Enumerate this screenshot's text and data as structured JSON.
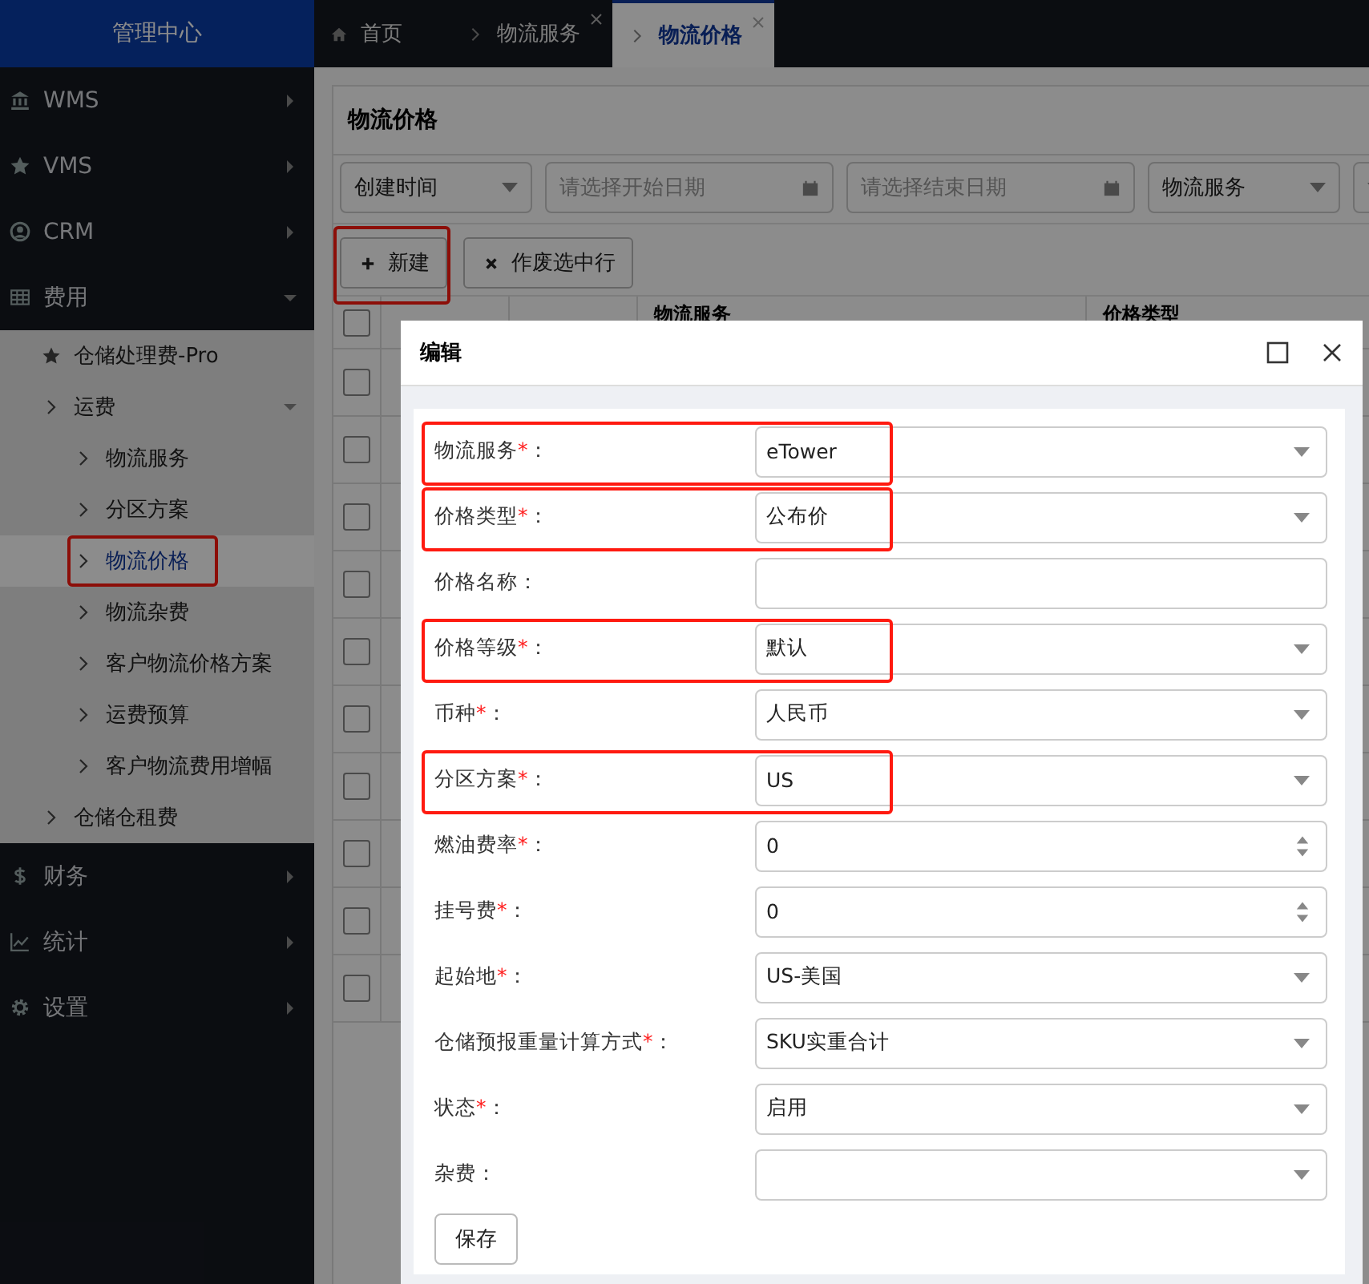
{
  "brand": "管理中心",
  "sidebar": {
    "items": [
      {
        "label": "WMS",
        "expanded": false
      },
      {
        "label": "VMS",
        "expanded": false
      },
      {
        "label": "CRM",
        "expanded": false
      },
      {
        "label": "费用",
        "expanded": true,
        "children": [
          {
            "label": "仓储处理费-Pro",
            "expanded": false,
            "selected": false,
            "highlighted": false
          },
          {
            "label": "运费",
            "expanded": true,
            "selected": false,
            "highlighted": false,
            "children": [
              {
                "label": "物流服务",
                "selected": false,
                "highlighted": false
              },
              {
                "label": "分区方案",
                "selected": false,
                "highlighted": false
              },
              {
                "label": "物流价格",
                "selected": true,
                "highlighted": true
              },
              {
                "label": "物流杂费",
                "selected": false,
                "highlighted": false
              },
              {
                "label": "客户物流价格方案",
                "selected": false,
                "highlighted": false
              },
              {
                "label": "运费预算",
                "selected": false,
                "highlighted": false
              },
              {
                "label": "客户物流费用增幅",
                "selected": false,
                "highlighted": false
              }
            ]
          },
          {
            "label": "仓储仓租费",
            "expanded": false,
            "selected": false,
            "highlighted": false
          }
        ]
      },
      {
        "label": "财务",
        "expanded": false
      },
      {
        "label": "统计",
        "expanded": false
      },
      {
        "label": "设置",
        "expanded": false
      }
    ]
  },
  "tabs": [
    {
      "label": "首页",
      "kind": "home",
      "selected": false,
      "closable": false
    },
    {
      "label": "物流服务",
      "kind": "page",
      "selected": false,
      "closable": true
    },
    {
      "label": "物流价格",
      "kind": "page",
      "selected": true,
      "closable": true
    }
  ],
  "page": {
    "title": "物流价格",
    "filters": [
      {
        "kind": "select",
        "value": "创建时间"
      },
      {
        "kind": "date",
        "placeholder": "请选择开始日期"
      },
      {
        "kind": "date",
        "placeholder": "请选择结束日期"
      },
      {
        "kind": "select",
        "value": "物流服务"
      },
      {
        "kind": "select"
      }
    ],
    "buttons": [
      {
        "label": "新建",
        "kind": "add",
        "highlighted": true
      },
      {
        "label": "作废选中行",
        "kind": "void",
        "highlighted": false
      }
    ],
    "table": {
      "all_checked": false,
      "columns": [
        "物流服务",
        "价格类型"
      ],
      "rows": [
        {
          "checked": false
        },
        {
          "checked": false
        },
        {
          "checked": false
        },
        {
          "checked": false
        },
        {
          "checked": false
        },
        {
          "checked": false
        },
        {
          "checked": false
        },
        {
          "checked": false
        },
        {
          "checked": false
        },
        {
          "checked": false
        }
      ]
    }
  },
  "dialog": {
    "title": "编辑",
    "fields": [
      {
        "label": "物流服务",
        "marker": "*",
        "suffix": "：",
        "kind": "select",
        "value": "eTower",
        "highlighted": true
      },
      {
        "label": "价格类型",
        "marker": "*",
        "suffix": "：",
        "kind": "select",
        "value": "公布价",
        "highlighted": true
      },
      {
        "label": "价格名称",
        "suffix": "：",
        "kind": "text",
        "highlighted": false
      },
      {
        "label": "价格等级",
        "marker": "*",
        "suffix": "：",
        "kind": "select",
        "value": "默认",
        "highlighted": true
      },
      {
        "label": "币种",
        "marker": "*",
        "suffix": "：",
        "kind": "select",
        "value": "人民币",
        "highlighted": false
      },
      {
        "label": "分区方案",
        "marker": "*",
        "suffix": "：",
        "kind": "select",
        "value": "US",
        "highlighted": true
      },
      {
        "label": "燃油费率",
        "marker": "*",
        "suffix": "：",
        "kind": "number",
        "value": "0",
        "highlighted": false
      },
      {
        "label": "挂号费",
        "marker": "*",
        "suffix": "：",
        "kind": "number",
        "value": "0",
        "highlighted": false
      },
      {
        "label": "起始地",
        "marker": "*",
        "suffix": "：",
        "kind": "select",
        "value": "US-美国",
        "highlighted": false
      },
      {
        "label": "仓储预报重量计算方式",
        "marker": "*",
        "suffix": "：",
        "kind": "select",
        "value": "SKU实重合计",
        "highlighted": false
      },
      {
        "label": "状态",
        "marker": "*",
        "suffix": "：",
        "kind": "select",
        "value": "启用",
        "highlighted": false
      },
      {
        "label": "杂费",
        "suffix": "：",
        "kind": "select",
        "highlighted": false
      }
    ],
    "save_button": "保存"
  }
}
